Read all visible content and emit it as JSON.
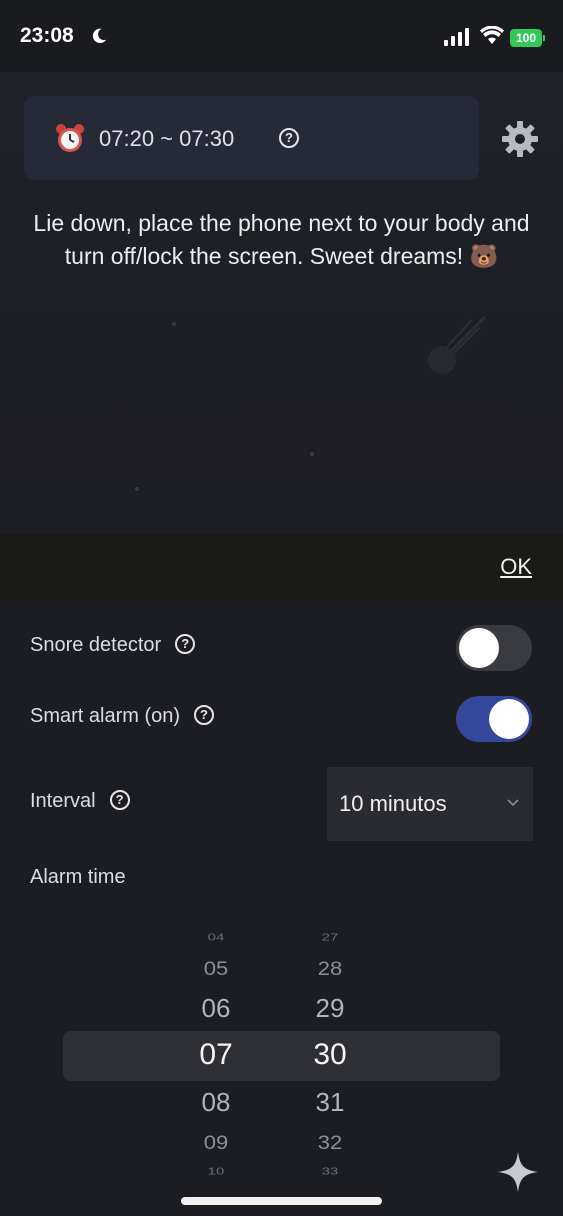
{
  "status_bar": {
    "time": "23:08",
    "battery": "100"
  },
  "alarm": {
    "range": "07:20 ~ 07:30"
  },
  "hero": {
    "message": "Lie down, place the phone next to your body and turn off/lock the screen. Sweet dreams! 🐻"
  },
  "ok_label": "OK",
  "settings": {
    "snore_detector": {
      "label": "Snore detector",
      "enabled": false
    },
    "smart_alarm": {
      "label": "Smart alarm (on)",
      "enabled": true
    },
    "interval": {
      "label": "Interval",
      "value": "10 minutos"
    },
    "alarm_time": {
      "label": "Alarm time"
    }
  },
  "picker": {
    "hours": [
      "04",
      "05",
      "06",
      "07",
      "08",
      "09",
      "10"
    ],
    "minutes": [
      "27",
      "28",
      "29",
      "30",
      "31",
      "32",
      "33"
    ],
    "selected_hour": "07",
    "selected_minute": "30"
  },
  "colors": {
    "accent_toggle": "#34479a",
    "battery": "#34c759",
    "card": "#262a36"
  }
}
